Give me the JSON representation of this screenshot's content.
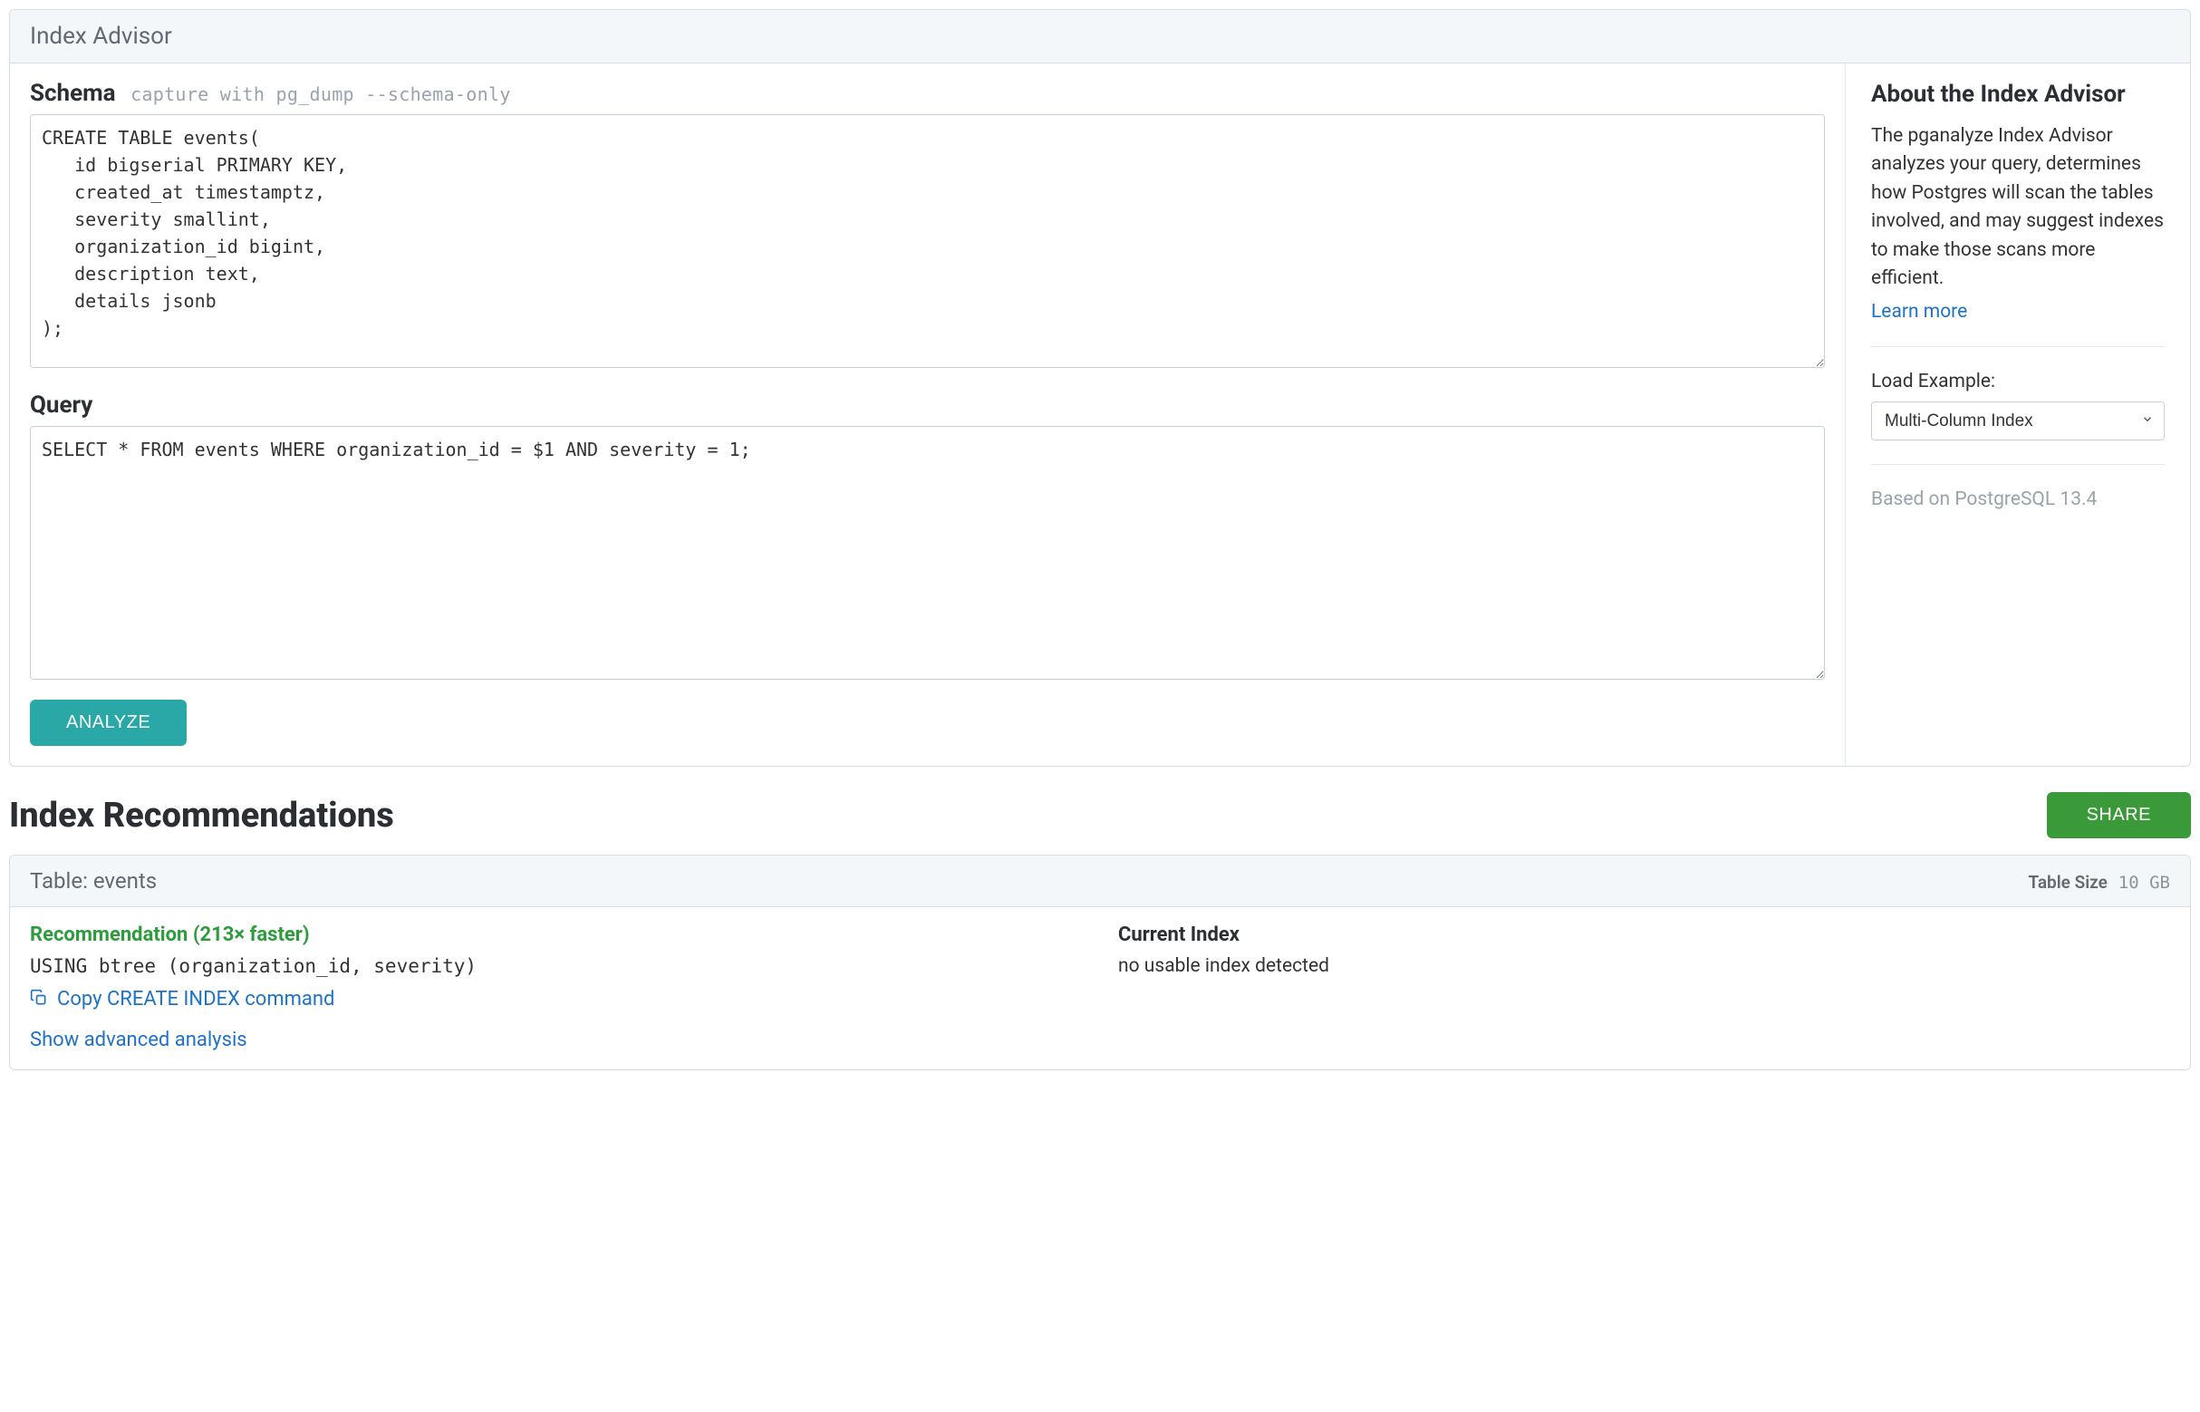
{
  "header": {
    "title": "Index Advisor"
  },
  "schema": {
    "label": "Schema",
    "hint": "capture with pg_dump --schema-only",
    "value": "CREATE TABLE events(\n   id bigserial PRIMARY KEY,\n   created_at timestamptz,\n   severity smallint,\n   organization_id bigint,\n   description text,\n   details jsonb\n);"
  },
  "query": {
    "label": "Query",
    "value": "SELECT * FROM events WHERE organization_id = $1 AND severity = 1;"
  },
  "buttons": {
    "analyze": "ANALYZE",
    "share": "SHARE"
  },
  "sidebar": {
    "about_title": "About the Index Advisor",
    "about_text": "The pganalyze Index Advisor analyzes your query, determines how Postgres will scan the tables involved, and may suggest indexes to make those scans more efficient.",
    "learn_more": "Learn more",
    "load_example_label": "Load Example:",
    "load_example_value": "Multi-Column Index",
    "based_on": "Based on PostgreSQL 13.4"
  },
  "recommendations": {
    "title": "Index Recommendations",
    "table_label": "Table: events",
    "table_size_label": "Table Size",
    "table_size_value": "10 GB",
    "rec_label": "Recommendation (213× faster)",
    "rec_value": "USING btree (organization_id, severity)",
    "copy_command": "Copy CREATE INDEX command",
    "current_index_label": "Current Index",
    "current_index_value": "no usable index detected",
    "show_advanced": "Show advanced analysis"
  }
}
